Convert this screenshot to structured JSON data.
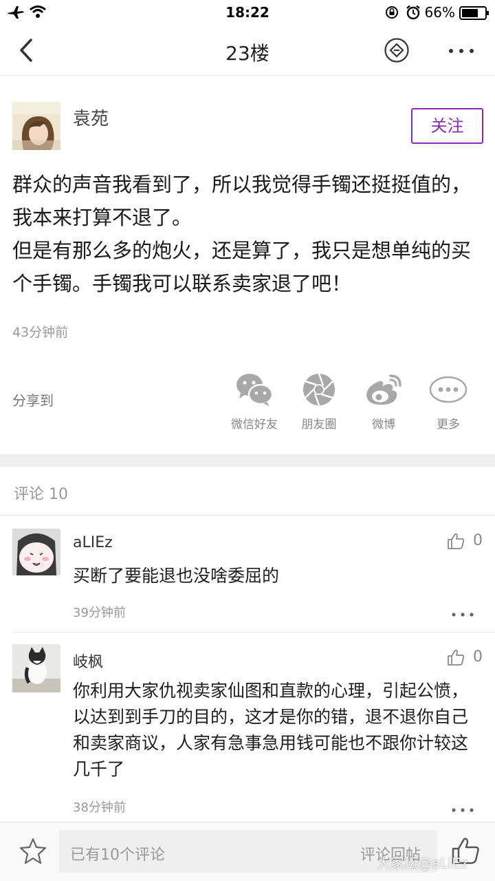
{
  "status_bar": {
    "time": "18:22",
    "battery_percent": "66%"
  },
  "nav": {
    "title": "23楼"
  },
  "post": {
    "author": "袁苑",
    "follow_label": "关注",
    "paragraphs": [
      "群众的声音我看到了，所以我觉得手镯还挺挺值的，我本来打算不退了。",
      "但是有那么多的炮火，还是算了，我只是想单纯的买个手镯。手镯我可以联系卖家退了吧！"
    ],
    "time": "43分钟前"
  },
  "share": {
    "label": "分享到",
    "targets": [
      {
        "label": "微信好友",
        "icon": "wechat-icon"
      },
      {
        "label": "朋友圈",
        "icon": "moments-icon"
      },
      {
        "label": "微博",
        "icon": "weibo-icon"
      },
      {
        "label": "更多",
        "icon": "more-icon"
      }
    ]
  },
  "comments_header": "评论 10",
  "comments": [
    {
      "author": "aLIEz",
      "text": "买断了要能退也没啥委屈的",
      "time": "39分钟前",
      "likes": "0"
    },
    {
      "author": "岐枫",
      "text": "你利用大家仇视卖家仙图和直款的心理，引起公愤，以达到到手刀的目的，这才是你的错，退不退你自己和卖家商议，人家有急事急用钱可能也不跟你计较这几千了",
      "time": "38分钟前",
      "likes": "0"
    }
  ],
  "bottom_bar": {
    "placeholder": "已有10个评论",
    "reply_label": "评论回帖",
    "watermark": "大家坛@aLIEz"
  },
  "colors": {
    "accent": "#8a2bb8",
    "icon_gray": "#a8a8a8"
  }
}
